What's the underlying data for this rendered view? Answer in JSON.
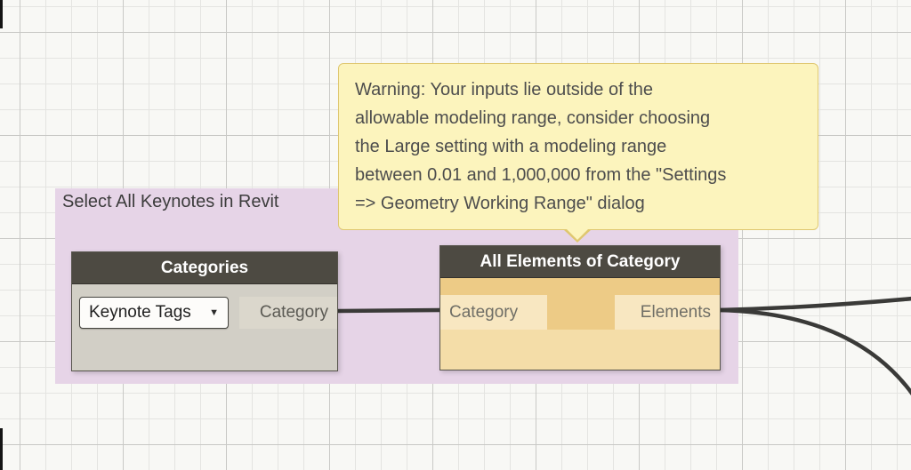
{
  "group": {
    "title": "Select All Keynotes in Revit",
    "color": "#e6d4e7"
  },
  "warning_tooltip": {
    "text": "Warning: Your inputs lie outside of the\nallowable modeling range, consider choosing\nthe Large setting with a modeling range\nbetween 0.01 and 1,000,000 from the \"Settings\n=> Geometry Working Range\" dialog",
    "background": "#fcf4bd",
    "border_color": "#dfc76f"
  },
  "nodes": {
    "categories": {
      "title": "Categories",
      "dropdown": {
        "value": "Keynote Tags",
        "caret": "▼"
      },
      "ports": {
        "output": "Category"
      }
    },
    "all_elements": {
      "title": "All Elements of Category",
      "ports": {
        "input": "Category",
        "output": "Elements"
      },
      "state": "warning",
      "state_color": "#edcb86"
    }
  },
  "wires": {
    "stroke_color": "#3a3a38"
  }
}
